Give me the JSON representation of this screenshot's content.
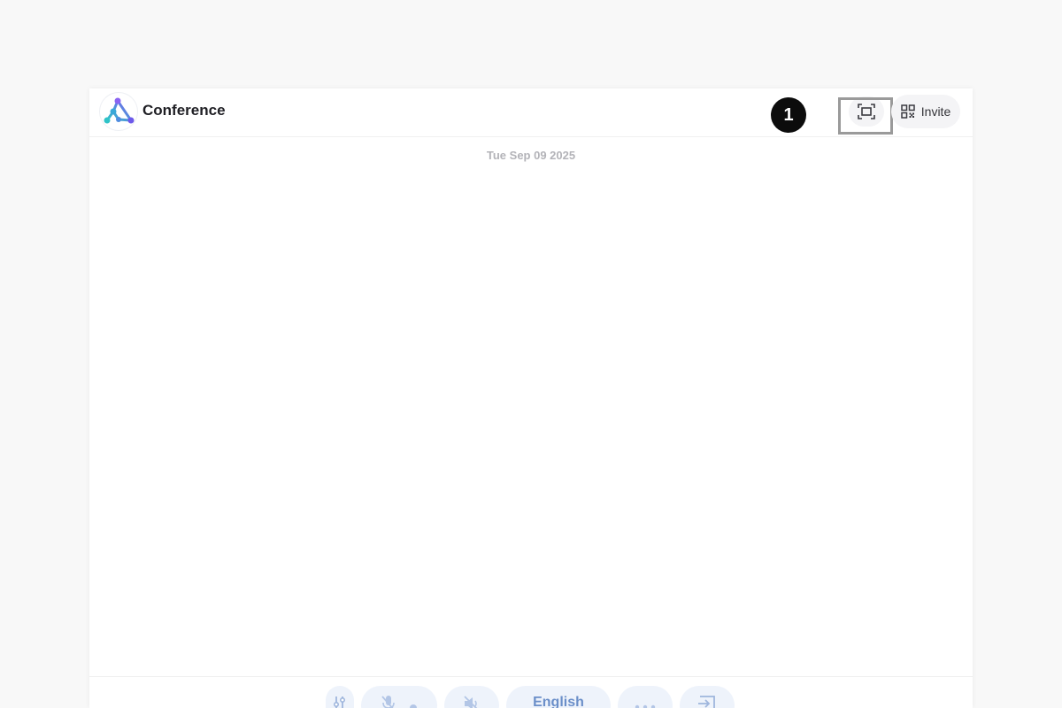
{
  "header": {
    "title": "Conference",
    "step_badge": "1",
    "fullscreen_icon": "fullscreen-icon",
    "invite_icon": "qr-code-icon",
    "invite_label": "Invite"
  },
  "chat": {
    "date": "Tue Sep 09 2025"
  },
  "footer": {
    "settings_icon": "sliders-icon",
    "mic_icon": "mic-off-icon",
    "speaker_icon": "speaker-off-icon",
    "language_label": "English",
    "more_icon": "more-icon",
    "exit_icon": "exit-icon"
  },
  "colors": {
    "accent": "#6b8fc9",
    "button_bg": "#eef3fb",
    "badge": "#0c0c0c",
    "highlight": "#9a9a9a"
  }
}
